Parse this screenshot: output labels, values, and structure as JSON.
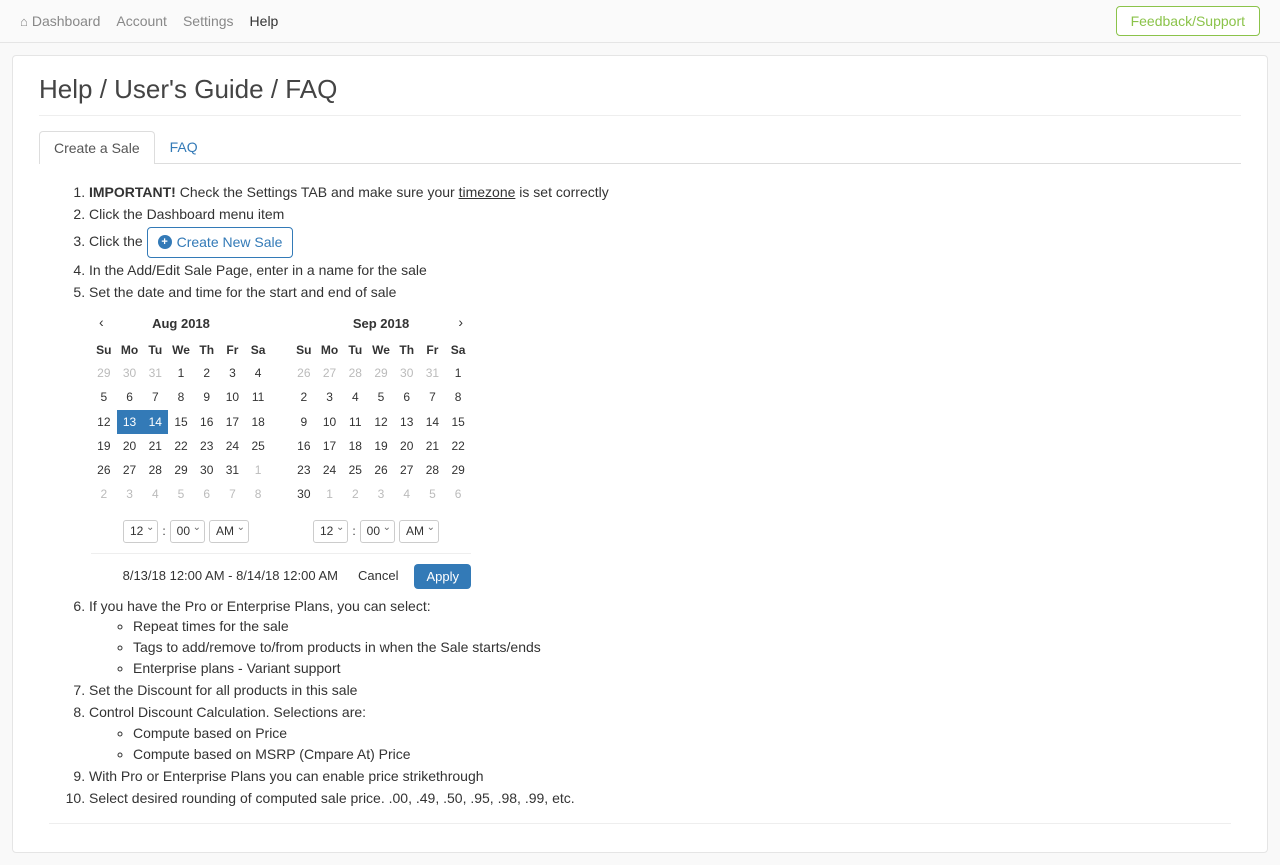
{
  "nav": {
    "dashboard": "Dashboard",
    "account": "Account",
    "settings": "Settings",
    "help": "Help",
    "feedback": "Feedback/Support"
  },
  "title": "Help / User's Guide / FAQ",
  "tabs": {
    "create": "Create a Sale",
    "faq": "FAQ"
  },
  "steps": {
    "s1a": "IMPORTANT!",
    "s1b": " Check the Settings TAB and make sure your ",
    "s1c": "timezone",
    "s1d": " is set correctly",
    "s2": "Click the Dashboard menu item",
    "s3a": "Click the ",
    "s3btn": "Create New Sale",
    "s4": "In the Add/Edit Sale Page, enter in a name for the sale",
    "s5": "Set the date and time for the start and end of sale",
    "s6": "If you have the Pro or Enterprise Plans, you can select:",
    "s6a": "Repeat times for the sale",
    "s6b": "Tags to add/remove to/from products in when the Sale starts/ends",
    "s6c": "Enterprise plans - Variant support",
    "s7": "Set the Discount for all products in this sale",
    "s8": "Control Discount Calculation. Selections are:",
    "s8a": "Compute based on Price",
    "s8b": "Compute based on MSRP (Cmpare At) Price",
    "s9": "With Pro or Enterprise Plans you can enable price strikethrough",
    "s10": "Select desired rounding of computed sale price. .00, .49, .50, .95, .98, .99, etc."
  },
  "cal": {
    "month1": "Aug 2018",
    "month2": "Sep 2018",
    "dow": [
      "Su",
      "Mo",
      "Tu",
      "We",
      "Th",
      "Fr",
      "Sa"
    ],
    "m1days": [
      {
        "d": "29",
        "m": 1
      },
      {
        "d": "30",
        "m": 1
      },
      {
        "d": "31",
        "m": 1
      },
      {
        "d": "1"
      },
      {
        "d": "2"
      },
      {
        "d": "3"
      },
      {
        "d": "4"
      },
      {
        "d": "5"
      },
      {
        "d": "6"
      },
      {
        "d": "7"
      },
      {
        "d": "8"
      },
      {
        "d": "9"
      },
      {
        "d": "10"
      },
      {
        "d": "11"
      },
      {
        "d": "12"
      },
      {
        "d": "13",
        "s": 1
      },
      {
        "d": "14",
        "s": 1
      },
      {
        "d": "15"
      },
      {
        "d": "16"
      },
      {
        "d": "17"
      },
      {
        "d": "18"
      },
      {
        "d": "19"
      },
      {
        "d": "20"
      },
      {
        "d": "21"
      },
      {
        "d": "22"
      },
      {
        "d": "23"
      },
      {
        "d": "24"
      },
      {
        "d": "25"
      },
      {
        "d": "26"
      },
      {
        "d": "27"
      },
      {
        "d": "28"
      },
      {
        "d": "29"
      },
      {
        "d": "30"
      },
      {
        "d": "31"
      },
      {
        "d": "1",
        "m": 1
      },
      {
        "d": "2",
        "m": 1
      },
      {
        "d": "3",
        "m": 1
      },
      {
        "d": "4",
        "m": 1
      },
      {
        "d": "5",
        "m": 1
      },
      {
        "d": "6",
        "m": 1
      },
      {
        "d": "7",
        "m": 1
      },
      {
        "d": "8",
        "m": 1
      }
    ],
    "m2days": [
      {
        "d": "26",
        "m": 1
      },
      {
        "d": "27",
        "m": 1
      },
      {
        "d": "28",
        "m": 1
      },
      {
        "d": "29",
        "m": 1
      },
      {
        "d": "30",
        "m": 1
      },
      {
        "d": "31",
        "m": 1
      },
      {
        "d": "1"
      },
      {
        "d": "2"
      },
      {
        "d": "3"
      },
      {
        "d": "4"
      },
      {
        "d": "5"
      },
      {
        "d": "6"
      },
      {
        "d": "7"
      },
      {
        "d": "8"
      },
      {
        "d": "9"
      },
      {
        "d": "10"
      },
      {
        "d": "11"
      },
      {
        "d": "12"
      },
      {
        "d": "13"
      },
      {
        "d": "14"
      },
      {
        "d": "15"
      },
      {
        "d": "16"
      },
      {
        "d": "17"
      },
      {
        "d": "18"
      },
      {
        "d": "19"
      },
      {
        "d": "20"
      },
      {
        "d": "21"
      },
      {
        "d": "22"
      },
      {
        "d": "23"
      },
      {
        "d": "24"
      },
      {
        "d": "25"
      },
      {
        "d": "26"
      },
      {
        "d": "27"
      },
      {
        "d": "28"
      },
      {
        "d": "29"
      },
      {
        "d": "30"
      },
      {
        "d": "1",
        "m": 1
      },
      {
        "d": "2",
        "m": 1
      },
      {
        "d": "3",
        "m": 1
      },
      {
        "d": "4",
        "m": 1
      },
      {
        "d": "5",
        "m": 1
      },
      {
        "d": "6",
        "m": 1
      }
    ],
    "hour": "12",
    "min": "00",
    "ampm": "AM",
    "colon": ":",
    "range": "8/13/18 12:00 AM - 8/14/18 12:00 AM",
    "cancel": "Cancel",
    "apply": "Apply"
  }
}
